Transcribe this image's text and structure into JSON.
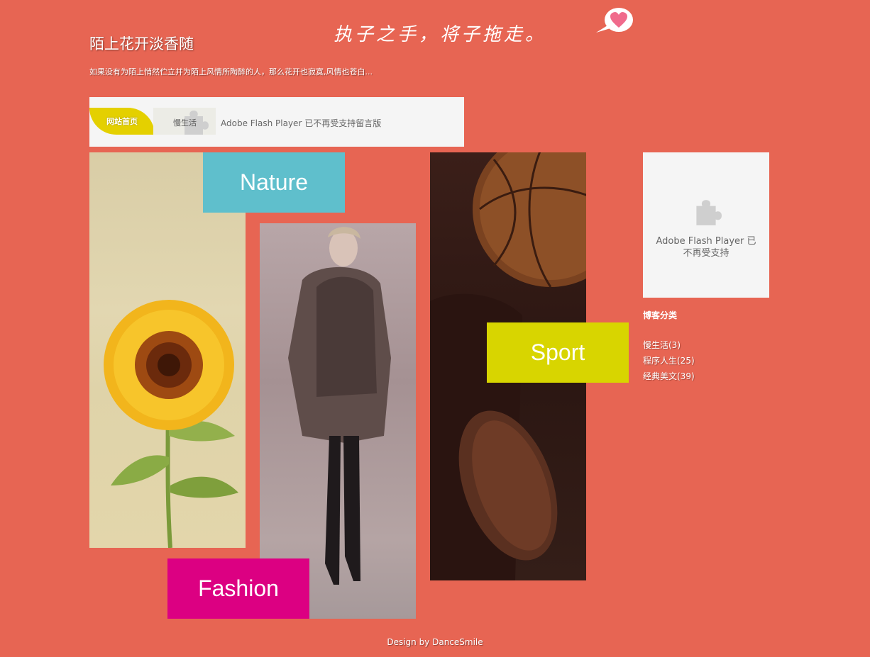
{
  "header": {
    "title": "陌上花开淡香随",
    "description": "如果没有为陌上悄然伫立并为陌上风情所陶醉的人，那么花开也寂寞,风情也苍白...",
    "slogan": "执子之手，将子拖走。"
  },
  "nav": {
    "home_label": "网站首页",
    "life_label": "慢生活",
    "flash_notice": "Adobe Flash Player 已不再受支持留言版"
  },
  "tiles": {
    "nature": "Nature",
    "fashion": "Fashion",
    "sport": "Sport"
  },
  "sidebar": {
    "flash_panel_text": "Adobe Flash Player 已不再受支持",
    "categories_title": "博客分类",
    "categories": [
      {
        "label": "慢生活(3)"
      },
      {
        "label": "程序人生(25)"
      },
      {
        "label": "经典美文(39)"
      }
    ]
  },
  "footer": {
    "credit": "Design by DanceSmile"
  },
  "colors": {
    "background": "#e76553",
    "nature": "#5fbfcc",
    "fashion": "#dc0082",
    "sport": "#d8d500",
    "nav_home": "#e4d000"
  },
  "icons": {
    "plugin": "puzzle-piece-icon",
    "bubble": "heart-speech-bubble-icon"
  }
}
